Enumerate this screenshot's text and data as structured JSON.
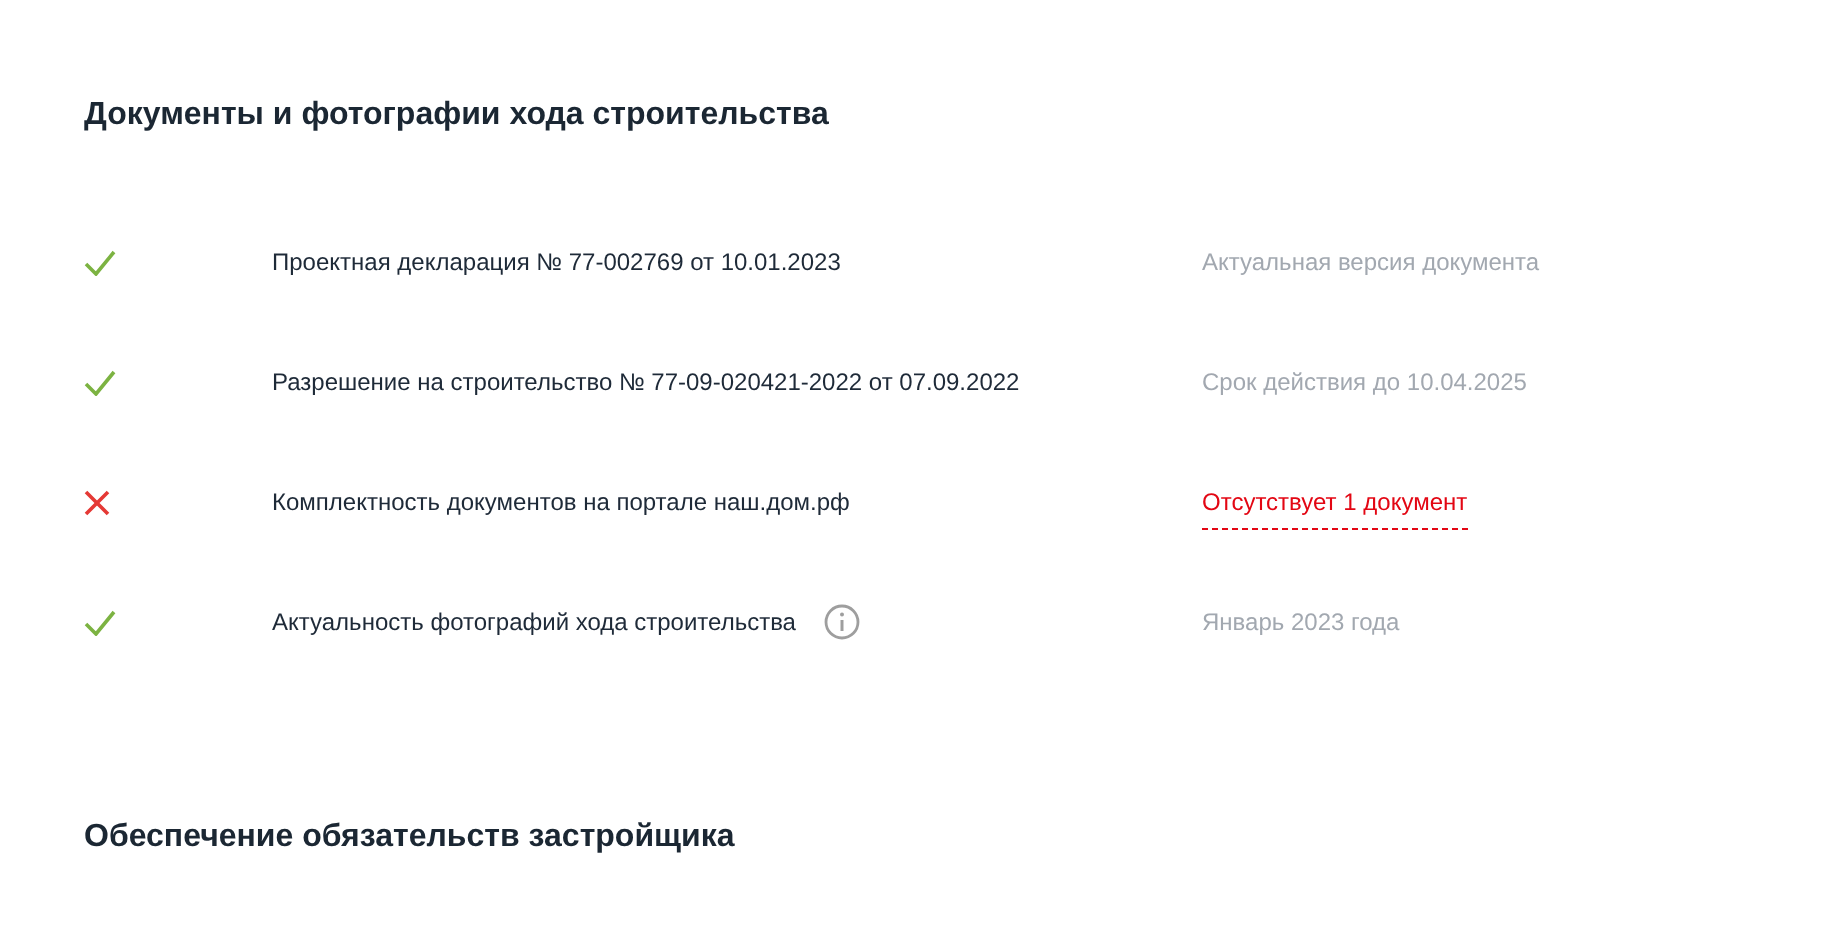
{
  "sections": [
    {
      "title": "Документы и фотографии хода строительства",
      "rows": [
        {
          "passed": true,
          "label": "Проектная декларация № 77-002769 от 10.01.2023",
          "status": {
            "kind": "note",
            "text": "Актуальная версия документа"
          }
        },
        {
          "passed": true,
          "label": "Разрешение на строительство № 77-09-020421-2022 от 07.09.2022",
          "status": {
            "kind": "note",
            "text": "Срок действия до 10.04.2025"
          }
        },
        {
          "passed": false,
          "label": "Комплектность документов на портале наш.дом.рф",
          "status": {
            "kind": "warning",
            "text": "Отсутствует 1 документ"
          }
        },
        {
          "passed": true,
          "label": "Актуальность фотографий хода строительства",
          "info": true,
          "status": {
            "kind": "note",
            "text": "Январь 2023 года"
          }
        }
      ]
    },
    {
      "title": "Обеспечение обязательств застройщика"
    }
  ]
}
